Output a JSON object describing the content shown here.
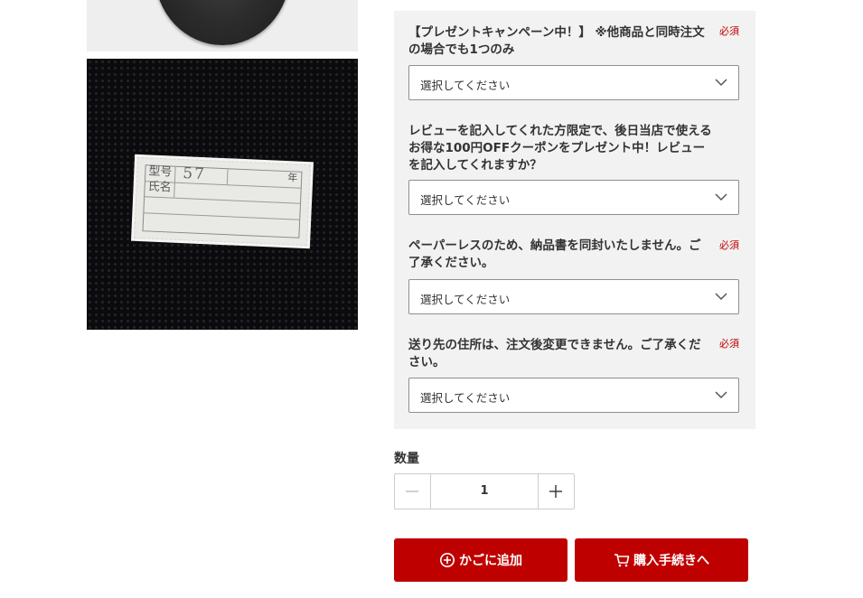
{
  "images": {
    "tag": {
      "field1": "型号",
      "field2": "氏名",
      "number": "57",
      "year": "年"
    }
  },
  "options": [
    {
      "label": "【プレゼントキャンペーン中！】 ※他商品と同時注文の場合でも1つのみ",
      "required": "必須",
      "select_value": "選択してください"
    },
    {
      "label": "レビューを記入してくれた方限定で、後日当店で使えるお得な100円OFFクーポンをプレゼント中！レビューを記入してくれますか？",
      "required": "",
      "select_value": "選択してください"
    },
    {
      "label": "ペーパーレスのため、納品書を同封いたしません。ご了承ください。",
      "required": "必須",
      "select_value": "選択してください"
    },
    {
      "label": "送り先の住所は、注文後変更できません。ご了承ください。",
      "required": "必須",
      "select_value": "選択してください"
    }
  ],
  "quantity": {
    "label": "数量",
    "value": "1",
    "minus_icon": "minus-icon",
    "plus_icon": "plus-icon"
  },
  "actions": {
    "add_to_cart": "かごに追加",
    "add_to_cart_icon": "plus-circle-icon",
    "checkout": "購入手続きへ",
    "checkout_icon": "cart-icon"
  },
  "colors": {
    "accent": "#bf0000",
    "panel_bg": "#f2f2f2",
    "text": "#333333"
  }
}
